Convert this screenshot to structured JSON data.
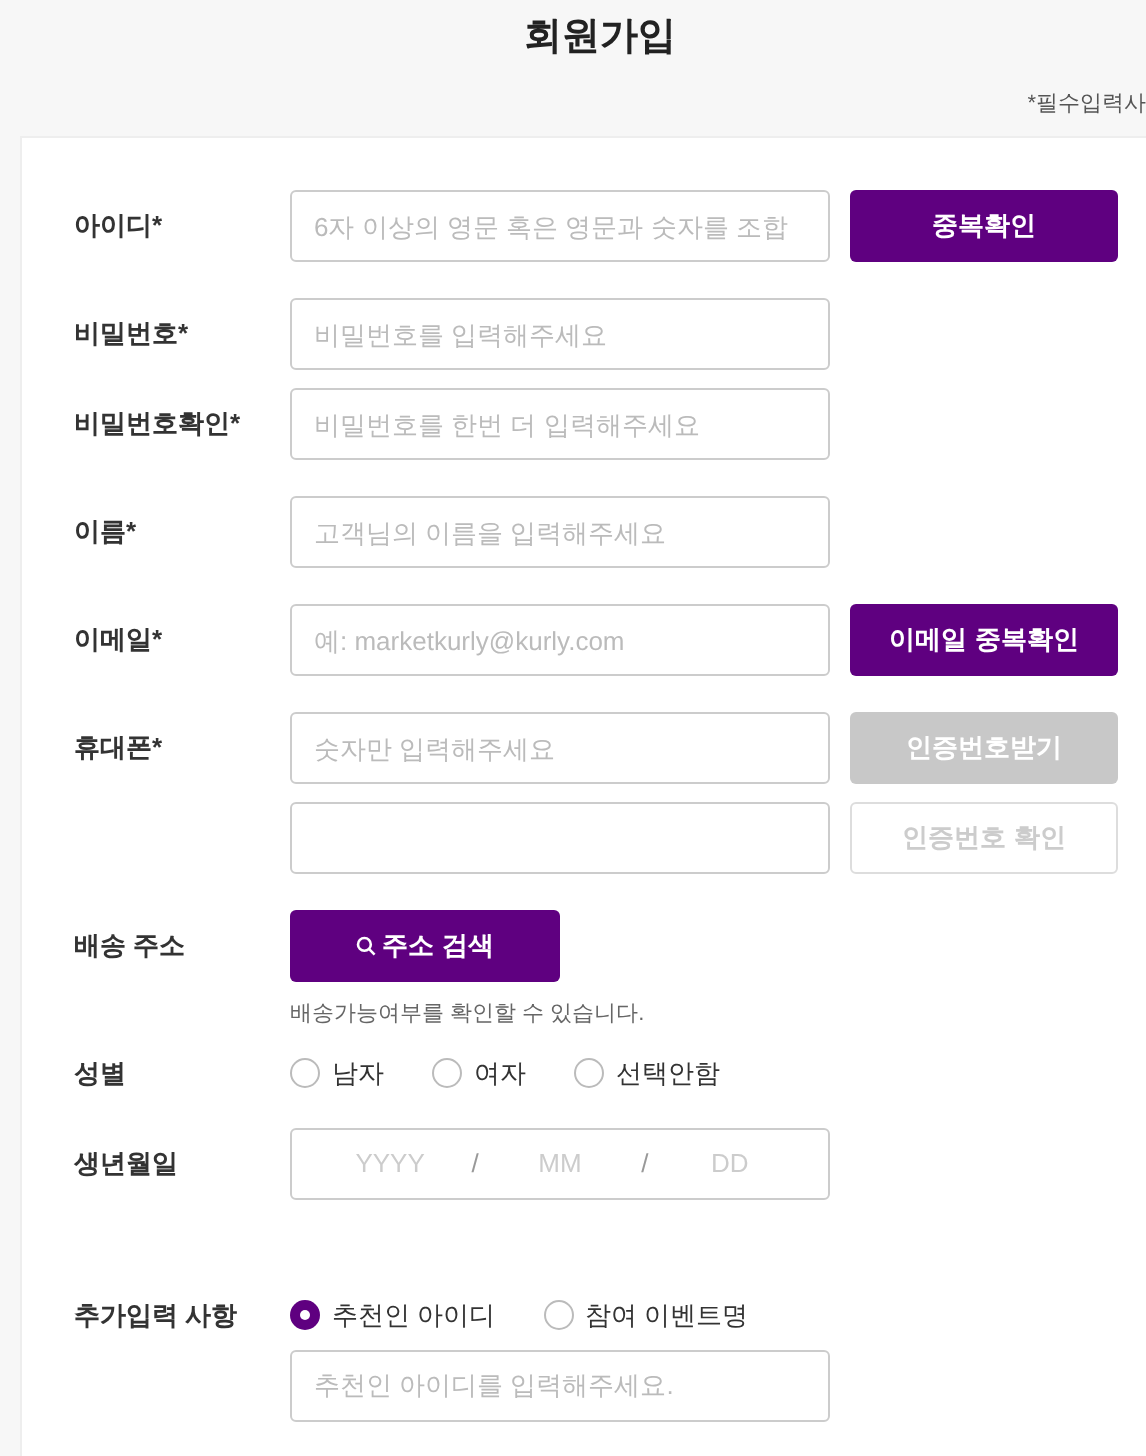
{
  "title": "회원가입",
  "required_note": "*필수입력사",
  "rows": [
    {
      "kind": "input",
      "label": "아이디*",
      "placeholder": "6자 이상의 영문 혹은 영문과 숫자를 조합",
      "button": {
        "label": "중복확인",
        "kind": "filled",
        "disabled": false
      }
    },
    {
      "kind": "input",
      "label": "비밀번호*",
      "placeholder": "비밀번호를 입력해주세요"
    },
    {
      "kind": "input",
      "label": "비밀번호확인*",
      "placeholder": "비밀번호를 한번 더 입력해주세요"
    },
    {
      "kind": "input",
      "label": "이름*",
      "placeholder": "고객님의 이름을 입력해주세요"
    },
    {
      "kind": "input",
      "label": "이메일*",
      "placeholder": "예: marketkurly@kurly.com",
      "button": {
        "label": "이메일 중복확인",
        "kind": "filled",
        "disabled": false
      }
    },
    {
      "kind": "input",
      "label": "휴대폰*",
      "placeholder": "숫자만 입력해주세요",
      "button": {
        "label": "인증번호받기",
        "kind": "filled",
        "disabled": true
      }
    },
    {
      "kind": "input",
      "button": {
        "label": "인증번호 확인",
        "kind": "outline",
        "disabled": true
      }
    },
    {
      "kind": "address",
      "label": "배송 주소",
      "button": {
        "label": "주소 검색"
      },
      "hint": "배송가능여부를 확인할 수 있습니다."
    },
    {
      "kind": "radio",
      "label": "성별",
      "options": [
        {
          "label": "남자",
          "selected": false
        },
        {
          "label": "여자",
          "selected": false
        },
        {
          "label": "선택안함",
          "selected": false
        }
      ]
    },
    {
      "kind": "date",
      "label": "생년월일",
      "parts": [
        {
          "placeholder": "YYYY"
        },
        {
          "separator": "/"
        },
        {
          "placeholder": "MM"
        },
        {
          "separator": "/"
        },
        {
          "placeholder": "DD"
        }
      ]
    },
    {
      "kind": "radio",
      "label": "추가입력 사항",
      "options": [
        {
          "label": "추천인 아이디",
          "selected": true
        },
        {
          "label": "참여 이벤트명",
          "selected": false
        }
      ]
    },
    {
      "kind": "input",
      "placeholder": "추천인 아이디를 입력해주세요."
    }
  ]
}
